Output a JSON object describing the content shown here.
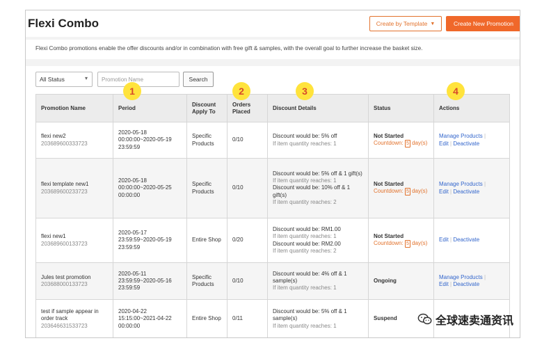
{
  "page": {
    "title": "Flexi Combo",
    "description": "Flexi Combo promotions enable the offer discounts and/or in combination with free gift & samples, with the overall goal to further increase the basket size."
  },
  "buttons": {
    "create_by_template": "Create by Template",
    "create_new": "Create New Promotion",
    "search": "Search"
  },
  "filters": {
    "status_value": "All Status",
    "search_placeholder": "Promotion Name"
  },
  "table": {
    "columns": [
      "Promotion Name",
      "Period",
      "Discount Apply To",
      "Orders Placed",
      "Discount Details",
      "Status",
      "Actions"
    ],
    "rows": [
      {
        "name": "flexi new2",
        "id": "203689600333723",
        "period": "2020-05-18 00:00:00~2020-05-19 23:59:59",
        "apply_to": "Specific Products",
        "orders": "0/10",
        "details": [
          {
            "main": "Discount would be: 5% off",
            "sub": "If item quantity reaches: 1"
          }
        ],
        "status": "Not Started",
        "countdown_label": "Countdown:",
        "countdown_value": "5",
        "countdown_unit": "day(s)",
        "actions": [
          "Manage Products",
          "Edit",
          "Deactivate"
        ]
      },
      {
        "name": "flexi template new1",
        "id": "203689600233723",
        "period": "2020-05-18 00:00:00~2020-05-25 00:00:00",
        "apply_to": "Specific Products",
        "orders": "0/10",
        "details": [
          {
            "main": "Discount would be: 5% off & 1 gift(s)",
            "sub": "If item quantity reaches: 1"
          },
          {
            "main": "Discount would be: 10% off & 1 gift(s)",
            "sub": "If item quantity reaches: 2"
          }
        ],
        "status": "Not Started",
        "countdown_label": "Countdown:",
        "countdown_value": "5",
        "countdown_unit": "day(s)",
        "actions": [
          "Manage Products",
          "Edit",
          "Deactivate"
        ]
      },
      {
        "name": "flexi new1",
        "id": "203689600133723",
        "period": "2020-05-17 23:59:59~2020-05-19 23:59:59",
        "apply_to": "Entire Shop",
        "orders": "0/20",
        "details": [
          {
            "main": "Discount would be: RM1.00",
            "sub": "If item quantity reaches: 1"
          },
          {
            "main": "Discount would be: RM2.00",
            "sub": "If item quantity reaches: 2"
          }
        ],
        "status": "Not Started",
        "countdown_label": "Countdown:",
        "countdown_value": "5",
        "countdown_unit": "day(s)",
        "actions": [
          "Edit",
          "Deactivate"
        ]
      },
      {
        "name": "Jules test promotion",
        "id": "203688000133723",
        "period": "2020-05-11 23:59:59~2020-05-16 23:59:59",
        "apply_to": "Specific Products",
        "orders": "0/10",
        "details": [
          {
            "main": "Discount would be: 4% off & 1 sample(s)",
            "sub": "If item quantity reaches: 1"
          }
        ],
        "status": "Ongoing",
        "actions": [
          "Manage Products",
          "Edit",
          "Deactivate"
        ]
      },
      {
        "name": "test if sample appear in order track",
        "id": "203646631533723",
        "period": "2020-04-22 15:15:00~2021-04-22 00:00:00",
        "apply_to": "Entire Shop",
        "orders": "0/11",
        "details": [
          {
            "main": "Discount would be: 5% off & 1 sample(s)",
            "sub": "If item quantity reaches: 1"
          }
        ],
        "status": "Suspend",
        "actions": []
      }
    ]
  },
  "annotations": [
    "1",
    "2",
    "3",
    "4"
  ],
  "watermark": {
    "text": "全球速卖通资讯",
    "icon": "wechat-icon"
  },
  "colors": {
    "accent": "#f0682a",
    "link": "#3366cc",
    "badge": "#ffe33c",
    "badge_text": "#d64a2b"
  }
}
